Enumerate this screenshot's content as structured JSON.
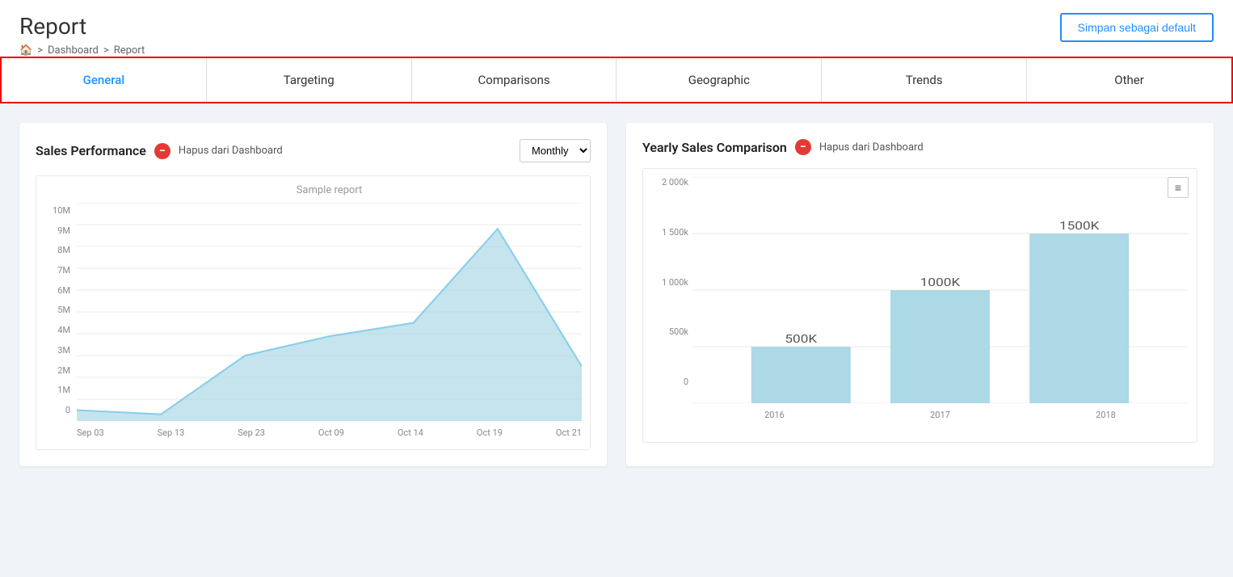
{
  "page": {
    "title": "Report",
    "breadcrumb": {
      "home_icon": "🏠",
      "items": [
        "Dashboard",
        "Report"
      ]
    },
    "save_button": "Simpan sebagai default"
  },
  "tabs": {
    "items": [
      {
        "label": "General",
        "active": true
      },
      {
        "label": "Targeting",
        "active": false
      },
      {
        "label": "Comparisons",
        "active": false
      },
      {
        "label": "Geographic",
        "active": false
      },
      {
        "label": "Trends",
        "active": false
      },
      {
        "label": "Other",
        "active": false
      }
    ]
  },
  "sales_performance": {
    "title": "Sales Performance",
    "remove_label": "Hapus dari Dashboard",
    "monthly_label": "Monthly",
    "chart_subtitle": "Sample report",
    "y_axis": [
      "10M",
      "9M",
      "8M",
      "7M",
      "6M",
      "5M",
      "4M",
      "3M",
      "2M",
      "1M",
      "0"
    ],
    "x_axis": [
      "Sep 03",
      "Sep 13",
      "Sep 23",
      "Oct 09",
      "Oct 14",
      "Oct 19",
      "Oct 21"
    ],
    "data_points": [
      0.5,
      0.3,
      3.0,
      3.9,
      4.5,
      8.8,
      2.5
    ]
  },
  "yearly_comparison": {
    "title": "Yearly Sales Comparison",
    "remove_label": "Hapus dari Dashboard",
    "hamburger_icon": "≡",
    "y_axis": [
      "2 000k",
      "1 500k",
      "1 000k",
      "500k",
      "0"
    ],
    "x_axis": [
      "2016",
      "2017",
      "2018"
    ],
    "bars": [
      {
        "year": "2016",
        "value": 500,
        "label": "500K"
      },
      {
        "year": "2017",
        "value": 1000,
        "label": "1000K"
      },
      {
        "year": "2018",
        "value": 1500,
        "label": "1500K"
      }
    ]
  }
}
